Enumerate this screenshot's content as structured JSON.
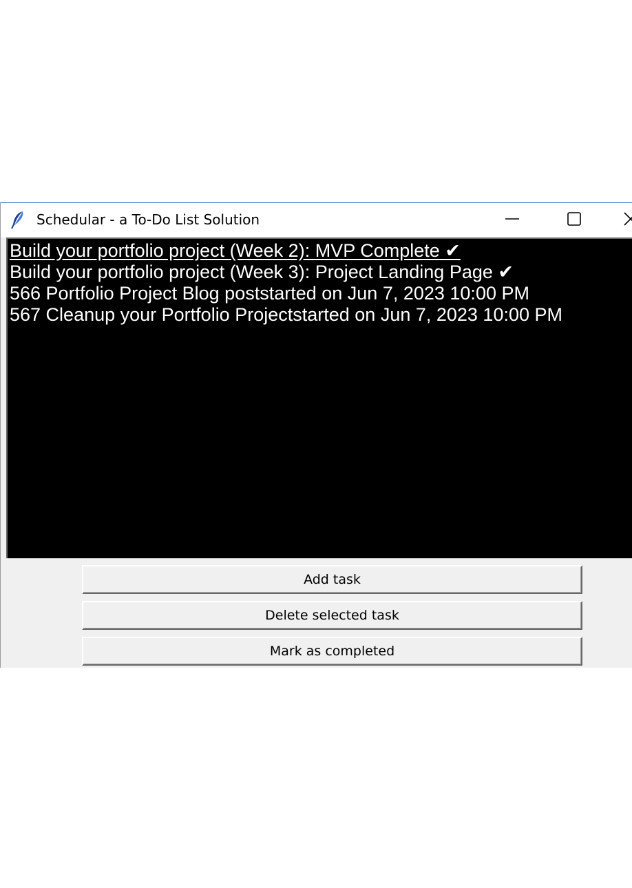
{
  "window": {
    "title": "Schedular - a To-Do List Solution",
    "icon": "feather-icon",
    "controls": {
      "minimize_icon": "minimize-icon",
      "maximize_icon": "maximize-icon",
      "close_icon": "close-icon"
    }
  },
  "tasks": [
    {
      "text": "Build your portfolio project (Week 2): MVP Complete  ✔",
      "active": true
    },
    {
      "text": "Build your portfolio project (Week 3): Project Landing Page ✔",
      "active": false
    },
    {
      "text": "566 Portfolio Project Blog poststarted on Jun 7, 2023 10:00 PM",
      "active": false
    },
    {
      "text": "567 Cleanup your Portfolio Projectstarted on Jun 7, 2023 10:00 PM",
      "active": false
    }
  ],
  "buttons": {
    "add_label": "Add task",
    "delete_label": "Delete selected task",
    "complete_label": "Mark as completed"
  },
  "colors": {
    "listbox_background": "#000000",
    "listbox_text": "#ffffff",
    "window_background": "#f0f0f0",
    "titlebar_background": "#ffffff"
  }
}
